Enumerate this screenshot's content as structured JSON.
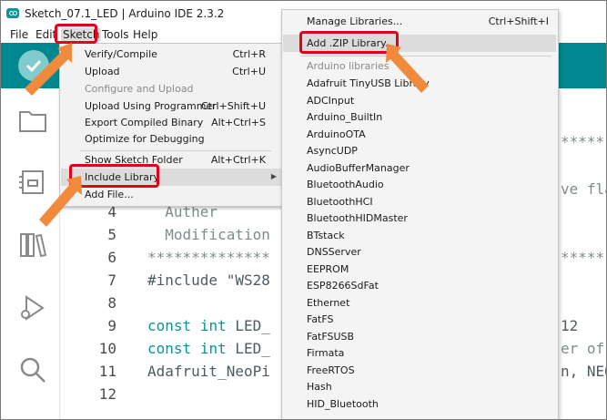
{
  "window": {
    "title": "Sketch_07.1_LED | Arduino IDE 2.3.2"
  },
  "menubar": {
    "file": "File",
    "edit": "Edit",
    "sketch": "Sketch",
    "tools": "Tools",
    "help": "Help"
  },
  "sketch_menu": {
    "items": [
      {
        "label": "Verify/Compile",
        "shortcut": "Ctrl+R"
      },
      {
        "label": "Upload",
        "shortcut": "Ctrl+U"
      },
      {
        "label": "Configure and Upload",
        "shortcut": ""
      },
      {
        "label": "Upload Using Programmer",
        "shortcut": "Ctrl+Shift+U"
      },
      {
        "label": "Export Compiled Binary",
        "shortcut": "Alt+Ctrl+S"
      },
      {
        "label": "Optimize for Debugging",
        "shortcut": ""
      },
      {
        "label": "Show Sketch Folder",
        "shortcut": "Alt+Ctrl+K"
      },
      {
        "label": "Include Library",
        "shortcut": ""
      },
      {
        "label": "Add File...",
        "shortcut": ""
      }
    ]
  },
  "library_menu": {
    "manage": {
      "label": "Manage Libraries...",
      "shortcut": "Ctrl+Shift+I"
    },
    "add_zip": {
      "label": "Add .ZIP Library..."
    },
    "section_header": "Arduino libraries",
    "libraries": [
      "Adafruit TinyUSB Library",
      "ADCInput",
      "Arduino_BuiltIn",
      "ArduinoOTA",
      "AsyncUDP",
      "AudioBufferManager",
      "BluetoothAudio",
      "BluetoothHCI",
      "BluetoothHIDMaster",
      "BTstack",
      "DNSServer",
      "EEPROM",
      "ESP8266SdFat",
      "Ethernet",
      "FatFS",
      "FatFSUSB",
      "Firmata",
      "FreeRTOS",
      "Hash",
      "HID_Bluetooth"
    ]
  },
  "editor": {
    "line_numbers": [
      "4",
      "5",
      "6",
      "7",
      "8",
      "9",
      "10",
      "11",
      "12"
    ],
    "lines": {
      "l4": "  Auther",
      "l5": "  Modification",
      "l6": "**************",
      "l7_prefix": "#include ",
      "l7_str": "\"WS28",
      "l9_kw1": "const",
      "l9_kw2": "int",
      "l9_rest": " LED_",
      "l10_kw1": "const",
      "l10_kw2": "int",
      "l10_rest": " LED_",
      "l11": "Adafruit_NeoPi",
      "hidden_right_1": "*****",
      "hidden_right_2": "ve fla",
      "hidden_right_3": "*****",
      "hidden_right_4": "12",
      "hidden_right_5": "er of",
      "hidden_right_6": "n, NEO"
    }
  },
  "colors": {
    "toolbar": "#00878f",
    "highlight": "#e3001b",
    "arrow": "#f08a3c"
  }
}
